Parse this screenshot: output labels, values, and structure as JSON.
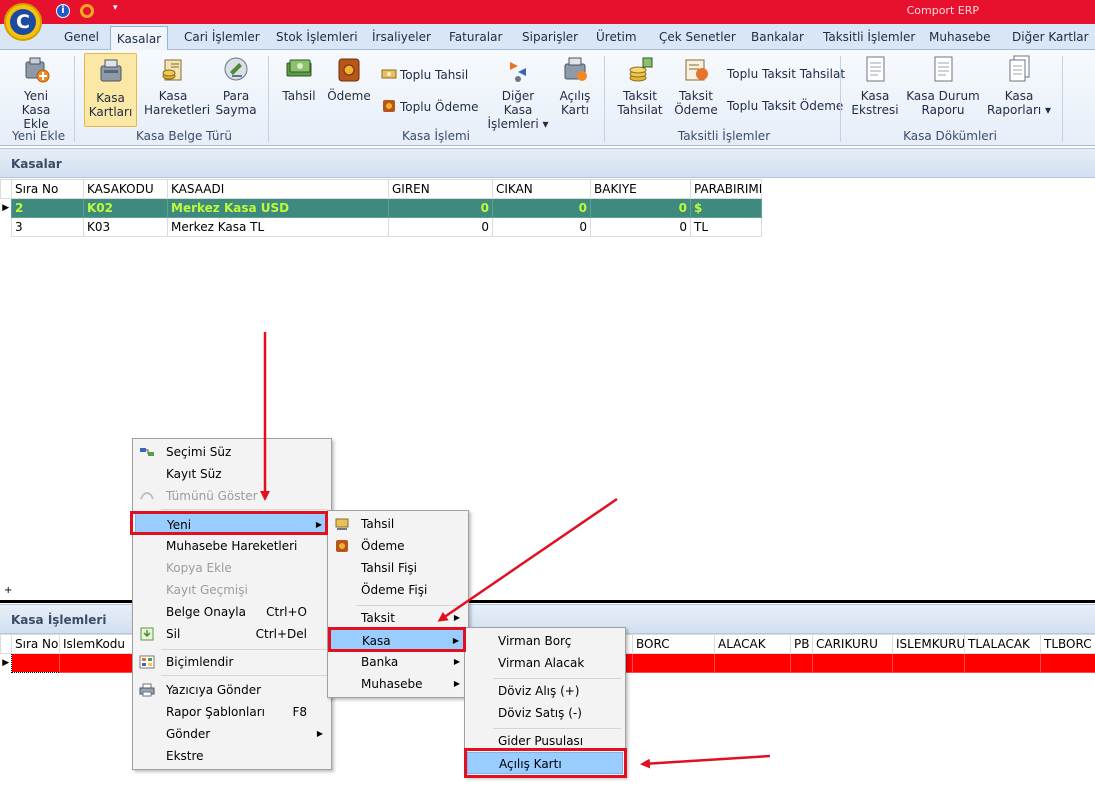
{
  "app": {
    "title": "Comport ERP",
    "logo_letter": "C",
    "qa_info_glyph": "i",
    "qa_drop_glyph": "▾"
  },
  "tabs": [
    "Genel",
    "Kasalar",
    "Cari İşlemler",
    "Stok İşlemleri",
    "İrsaliyeler",
    "Faturalar",
    "Siparişler",
    "Üretim",
    "Çek Senetler",
    "Bankalar",
    "Taksitli İşlemler",
    "Muhasebe",
    "Diğer Kartlar"
  ],
  "active_tab": "Kasalar",
  "ribbon": {
    "yeni_kasa_ekle": [
      "Yeni",
      "Kasa Ekle"
    ],
    "kasa_kartlari": [
      "Kasa",
      "Kartları"
    ],
    "kasa_hareketleri": [
      "Kasa",
      "Hareketleri"
    ],
    "para_sayma": [
      "Para",
      "Sayma"
    ],
    "tahsil": "Tahsil",
    "odeme": "Ödeme",
    "toplu_tahsil": "Toplu Tahsil",
    "toplu_odeme": "Toplu Ödeme",
    "diger_kasa_islemleri": [
      "Diğer Kasa",
      "İşlemleri ▾"
    ],
    "acilis_karti": [
      "Açılış",
      "Kartı"
    ],
    "taksit_tahsilat": [
      "Taksit",
      "Tahsilat"
    ],
    "taksit_odeme": [
      "Taksit",
      "Ödeme"
    ],
    "toplu_taksit_tahsilat": "Toplu Taksit Tahsilat",
    "toplu_taksit_odeme": "Toplu Taksit Ödeme",
    "kasa_ekstresi": [
      "Kasa",
      "Ekstresi"
    ],
    "kasa_durum_raporu": [
      "Kasa Durum",
      "Raporu"
    ],
    "kasa_raporlari": [
      "Kasa",
      "Raporları ▾"
    ],
    "groups": {
      "yeni_ekle": "Yeni Ekle",
      "kasa_belge_turu": "Kasa Belge Türü",
      "kasa_islemi": "Kasa İşlemi",
      "taksitli_islemler": "Taksitli İşlemler",
      "kasa_dokumleri": "Kasa Dökümleri"
    }
  },
  "kasalar": {
    "title": "Kasalar",
    "columns": [
      "Sıra No",
      "KASAKODU",
      "KASAADI",
      "GIREN",
      "CIKAN",
      "BAKIYE",
      "PARABIRIMI"
    ],
    "rows": [
      [
        "2",
        "K02",
        "Merkez Kasa USD",
        "0",
        "0",
        "0",
        "$"
      ],
      [
        "3",
        "K03",
        "Merkez Kasa TL",
        "0",
        "0",
        "0",
        "TL"
      ]
    ],
    "plus_glyph": "+"
  },
  "kasa_islemleri": {
    "title": "Kasa İşlemleri",
    "left_columns": [
      "Sıra No",
      "IslemKodu"
    ],
    "right_columns": [
      "BORC",
      "ALACAK",
      "PB",
      "CARIKURU",
      "ISLEMKURU",
      "TLALACAK",
      "TLBORC"
    ]
  },
  "context_menu": {
    "secimi_suz": "Seçimi Süz",
    "kayit_suz": "Kayıt Süz",
    "tumunu_goster": "Tümünü Göster",
    "yeni": "Yeni",
    "muhasebe_hareketleri": "Muhasebe Hareketleri",
    "kopya_ekle": "Kopya Ekle",
    "kayit_gecmisi": "Kayıt Geçmişi",
    "belge_onayla": "Belge Onayla",
    "belge_onayla_sc": "Ctrl+O",
    "sil": "Sil",
    "sil_sc": "Ctrl+Del",
    "bicimlendir": "Biçimlendir",
    "yaziciya_gonder": "Yazıcıya Gönder",
    "rapor_sablonlari": "Rapor Şablonları",
    "rapor_sablonlari_sc": "F8",
    "gonder": "Gönder",
    "ekstre": "Ekstre"
  },
  "submenu_yeni": {
    "tahsil": "Tahsil",
    "odeme": "Ödeme",
    "tahsil_fisi": "Tahsil Fişi",
    "odeme_fisi": "Ödeme Fişi",
    "taksit": "Taksit",
    "kasa": "Kasa",
    "banka": "Banka",
    "muhasebe": "Muhasebe"
  },
  "submenu_kasa": {
    "virman_borc": "Virman Borç",
    "virman_alacak": "Virman Alacak",
    "doviz_alis": "Döviz Alış (+)",
    "doviz_satis": "Döviz Satış (-)",
    "gider_pusulasi": "Gider Pusulası",
    "acilis_karti": "Açılış Kartı"
  },
  "glyphs": {
    "row_pointer": "▶",
    "submenu_arrow": "▶"
  },
  "colors": {
    "title_bar": "#e8112d",
    "selected_row": "#3f8a7f",
    "selected_row_text": "#bffa3a",
    "highlight": "#99ccff",
    "annotation_red": "#e01020",
    "edit_row": "#ff0000"
  }
}
